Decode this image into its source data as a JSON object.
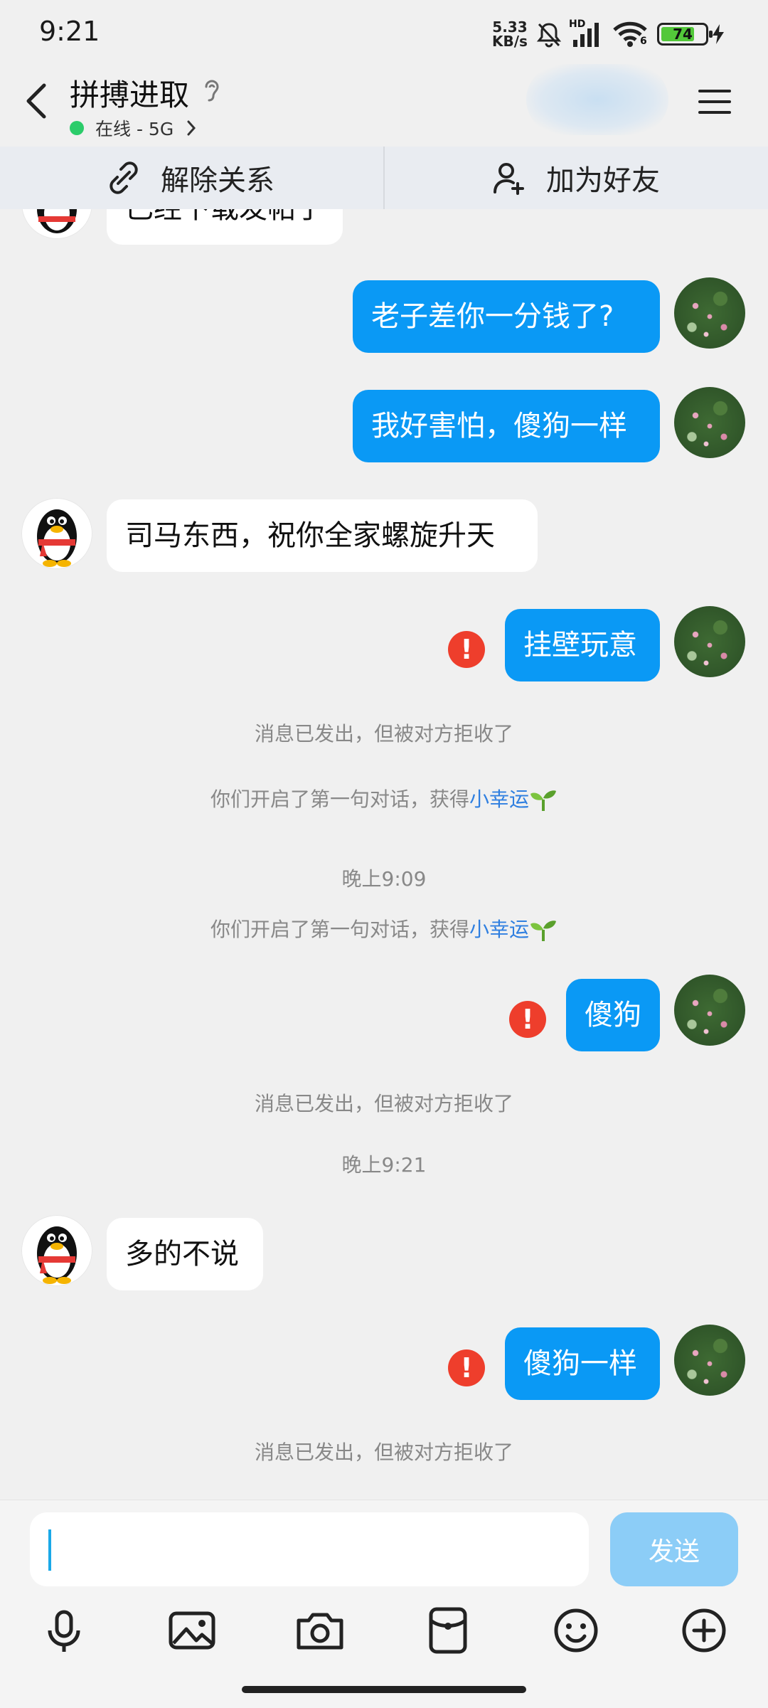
{
  "status_bar": {
    "time": "9:21",
    "net_speed_value": "5.33",
    "net_speed_unit": "KB/s",
    "signal_label": "HD",
    "wifi_label": "6",
    "battery": "74"
  },
  "header": {
    "contact_name": "拼搏进取",
    "presence": "在线 - 5G"
  },
  "actions": {
    "remove": "解除关系",
    "add_friend": "加为好友"
  },
  "messages": {
    "partial": "已经下载发帖了",
    "m1": "老子差你一分钱了?",
    "m2": "我好害怕，傻狗一样",
    "m3": "司马东西，祝你全家螺旋升天",
    "m4": "挂壁玩意",
    "m5": "傻狗",
    "m6": "多的不说",
    "m7": "傻狗一样"
  },
  "system": {
    "rejected": "消息已发出，但被对方拒收了",
    "first_chat_prefix": "你们开启了第一句对话，获得",
    "first_chat_link": "小幸运",
    "time1": "晚上9:09",
    "time2": "晚上9:21"
  },
  "composer": {
    "input_value": "",
    "send_label": "发送"
  },
  "colors": {
    "outgoing_bubble": "#0a99f5",
    "incoming_bubble": "#ffffff",
    "error": "#ee3e2c",
    "link": "#2f7fe0",
    "send_disabled": "#8ccdf7"
  }
}
